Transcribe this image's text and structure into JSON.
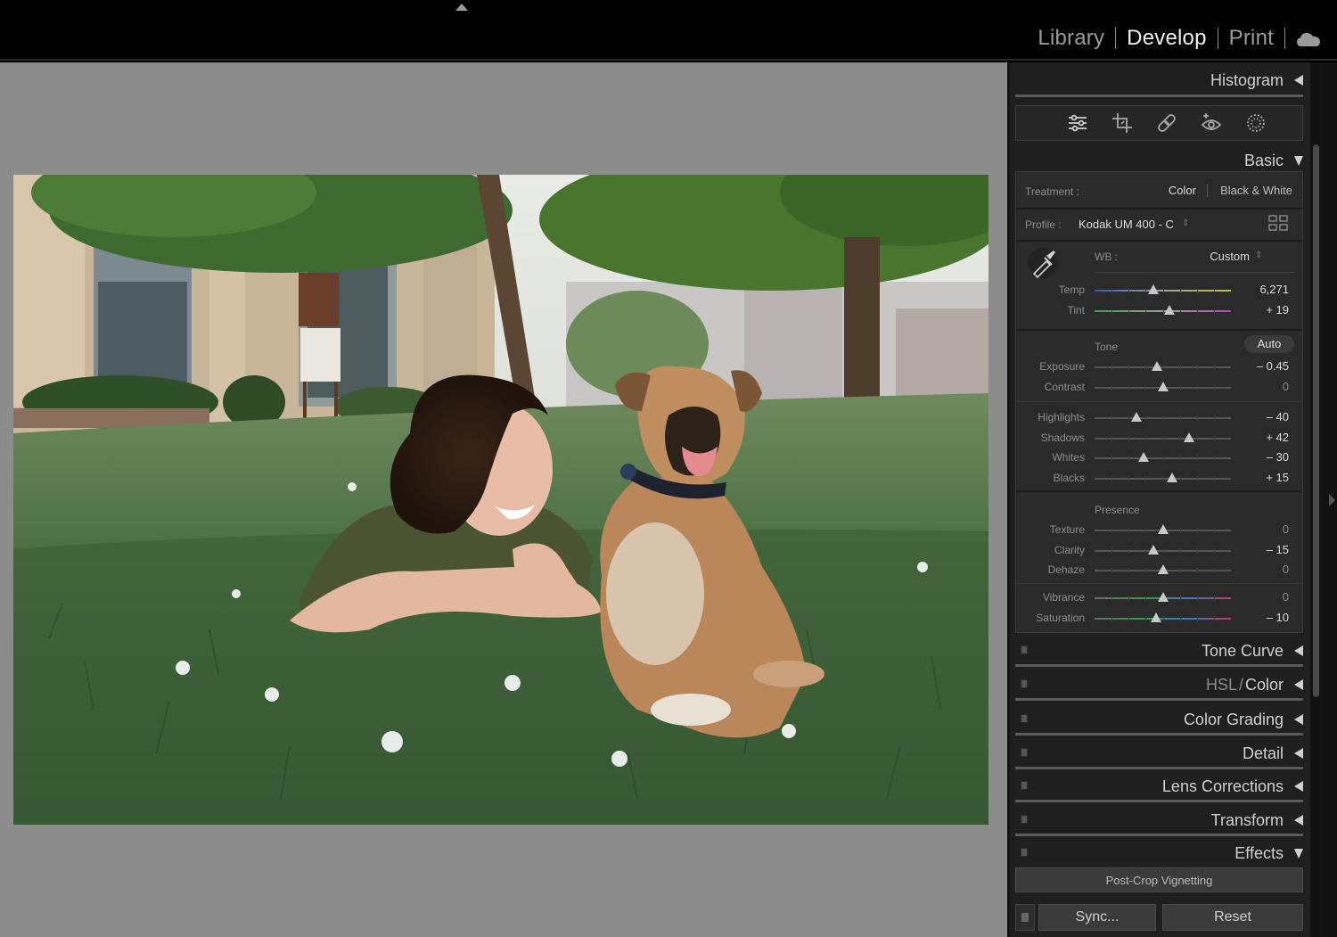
{
  "modules": {
    "library": "Library",
    "develop": "Develop",
    "print": "Print"
  },
  "panel": {
    "histogram": "Histogram",
    "basic": "Basic",
    "treatment_label": "Treatment :",
    "treatment_color": "Color",
    "treatment_bw": "Black & White",
    "profile_label": "Profile :",
    "profile_value": "Kodak UM 400 - C",
    "wb_label": "WB :",
    "wb_value": "Custom",
    "tone_label": "Tone",
    "auto_label": "Auto",
    "presence_label": "Presence",
    "sliders": [
      {
        "label": "Temp",
        "value": "6,271",
        "pos": 0.43,
        "track": "temp"
      },
      {
        "label": "Tint",
        "value": "+ 19",
        "pos": 0.55,
        "track": "tint"
      },
      {
        "label": "Exposure",
        "value": "– 0.45",
        "pos": 0.46,
        "track": "gray"
      },
      {
        "label": "Contrast",
        "value": "0",
        "pos": 0.5,
        "track": "gray"
      },
      {
        "label": "Highlights",
        "value": "– 40",
        "pos": 0.31,
        "track": "gray"
      },
      {
        "label": "Shadows",
        "value": "+ 42",
        "pos": 0.69,
        "track": "gray"
      },
      {
        "label": "Whites",
        "value": "– 30",
        "pos": 0.36,
        "track": "gray"
      },
      {
        "label": "Blacks",
        "value": "+ 15",
        "pos": 0.57,
        "track": "gray"
      },
      {
        "label": "Texture",
        "value": "0",
        "pos": 0.5,
        "track": "gray"
      },
      {
        "label": "Clarity",
        "value": "– 15",
        "pos": 0.43,
        "track": "gray"
      },
      {
        "label": "Dehaze",
        "value": "0",
        "pos": 0.5,
        "track": "gray"
      },
      {
        "label": "Vibrance",
        "value": "0",
        "pos": 0.5,
        "track": "vib"
      },
      {
        "label": "Saturation",
        "value": "– 10",
        "pos": 0.45,
        "track": "vib"
      }
    ],
    "sections": {
      "tone_curve": "Tone Curve",
      "hsl": "HSL",
      "hsl_slash": "/",
      "hsl_color": "Color",
      "color_grading": "Color Grading",
      "detail": "Detail",
      "lens_corrections": "Lens Corrections",
      "transform": "Transform",
      "effects": "Effects"
    },
    "post_crop": "Post-Crop Vignetting",
    "sync": "Sync...",
    "reset": "Reset"
  },
  "colors": {
    "accent": "#cfcfcf",
    "panel_bg": "#1f1f1f",
    "canvas_bg": "#8c8c8c"
  },
  "icons": [
    "basic-adjust-icon",
    "crop-icon",
    "healing-icon",
    "red-eye-icon",
    "masking-icon",
    "eyedropper-icon",
    "cloud-icon"
  ]
}
